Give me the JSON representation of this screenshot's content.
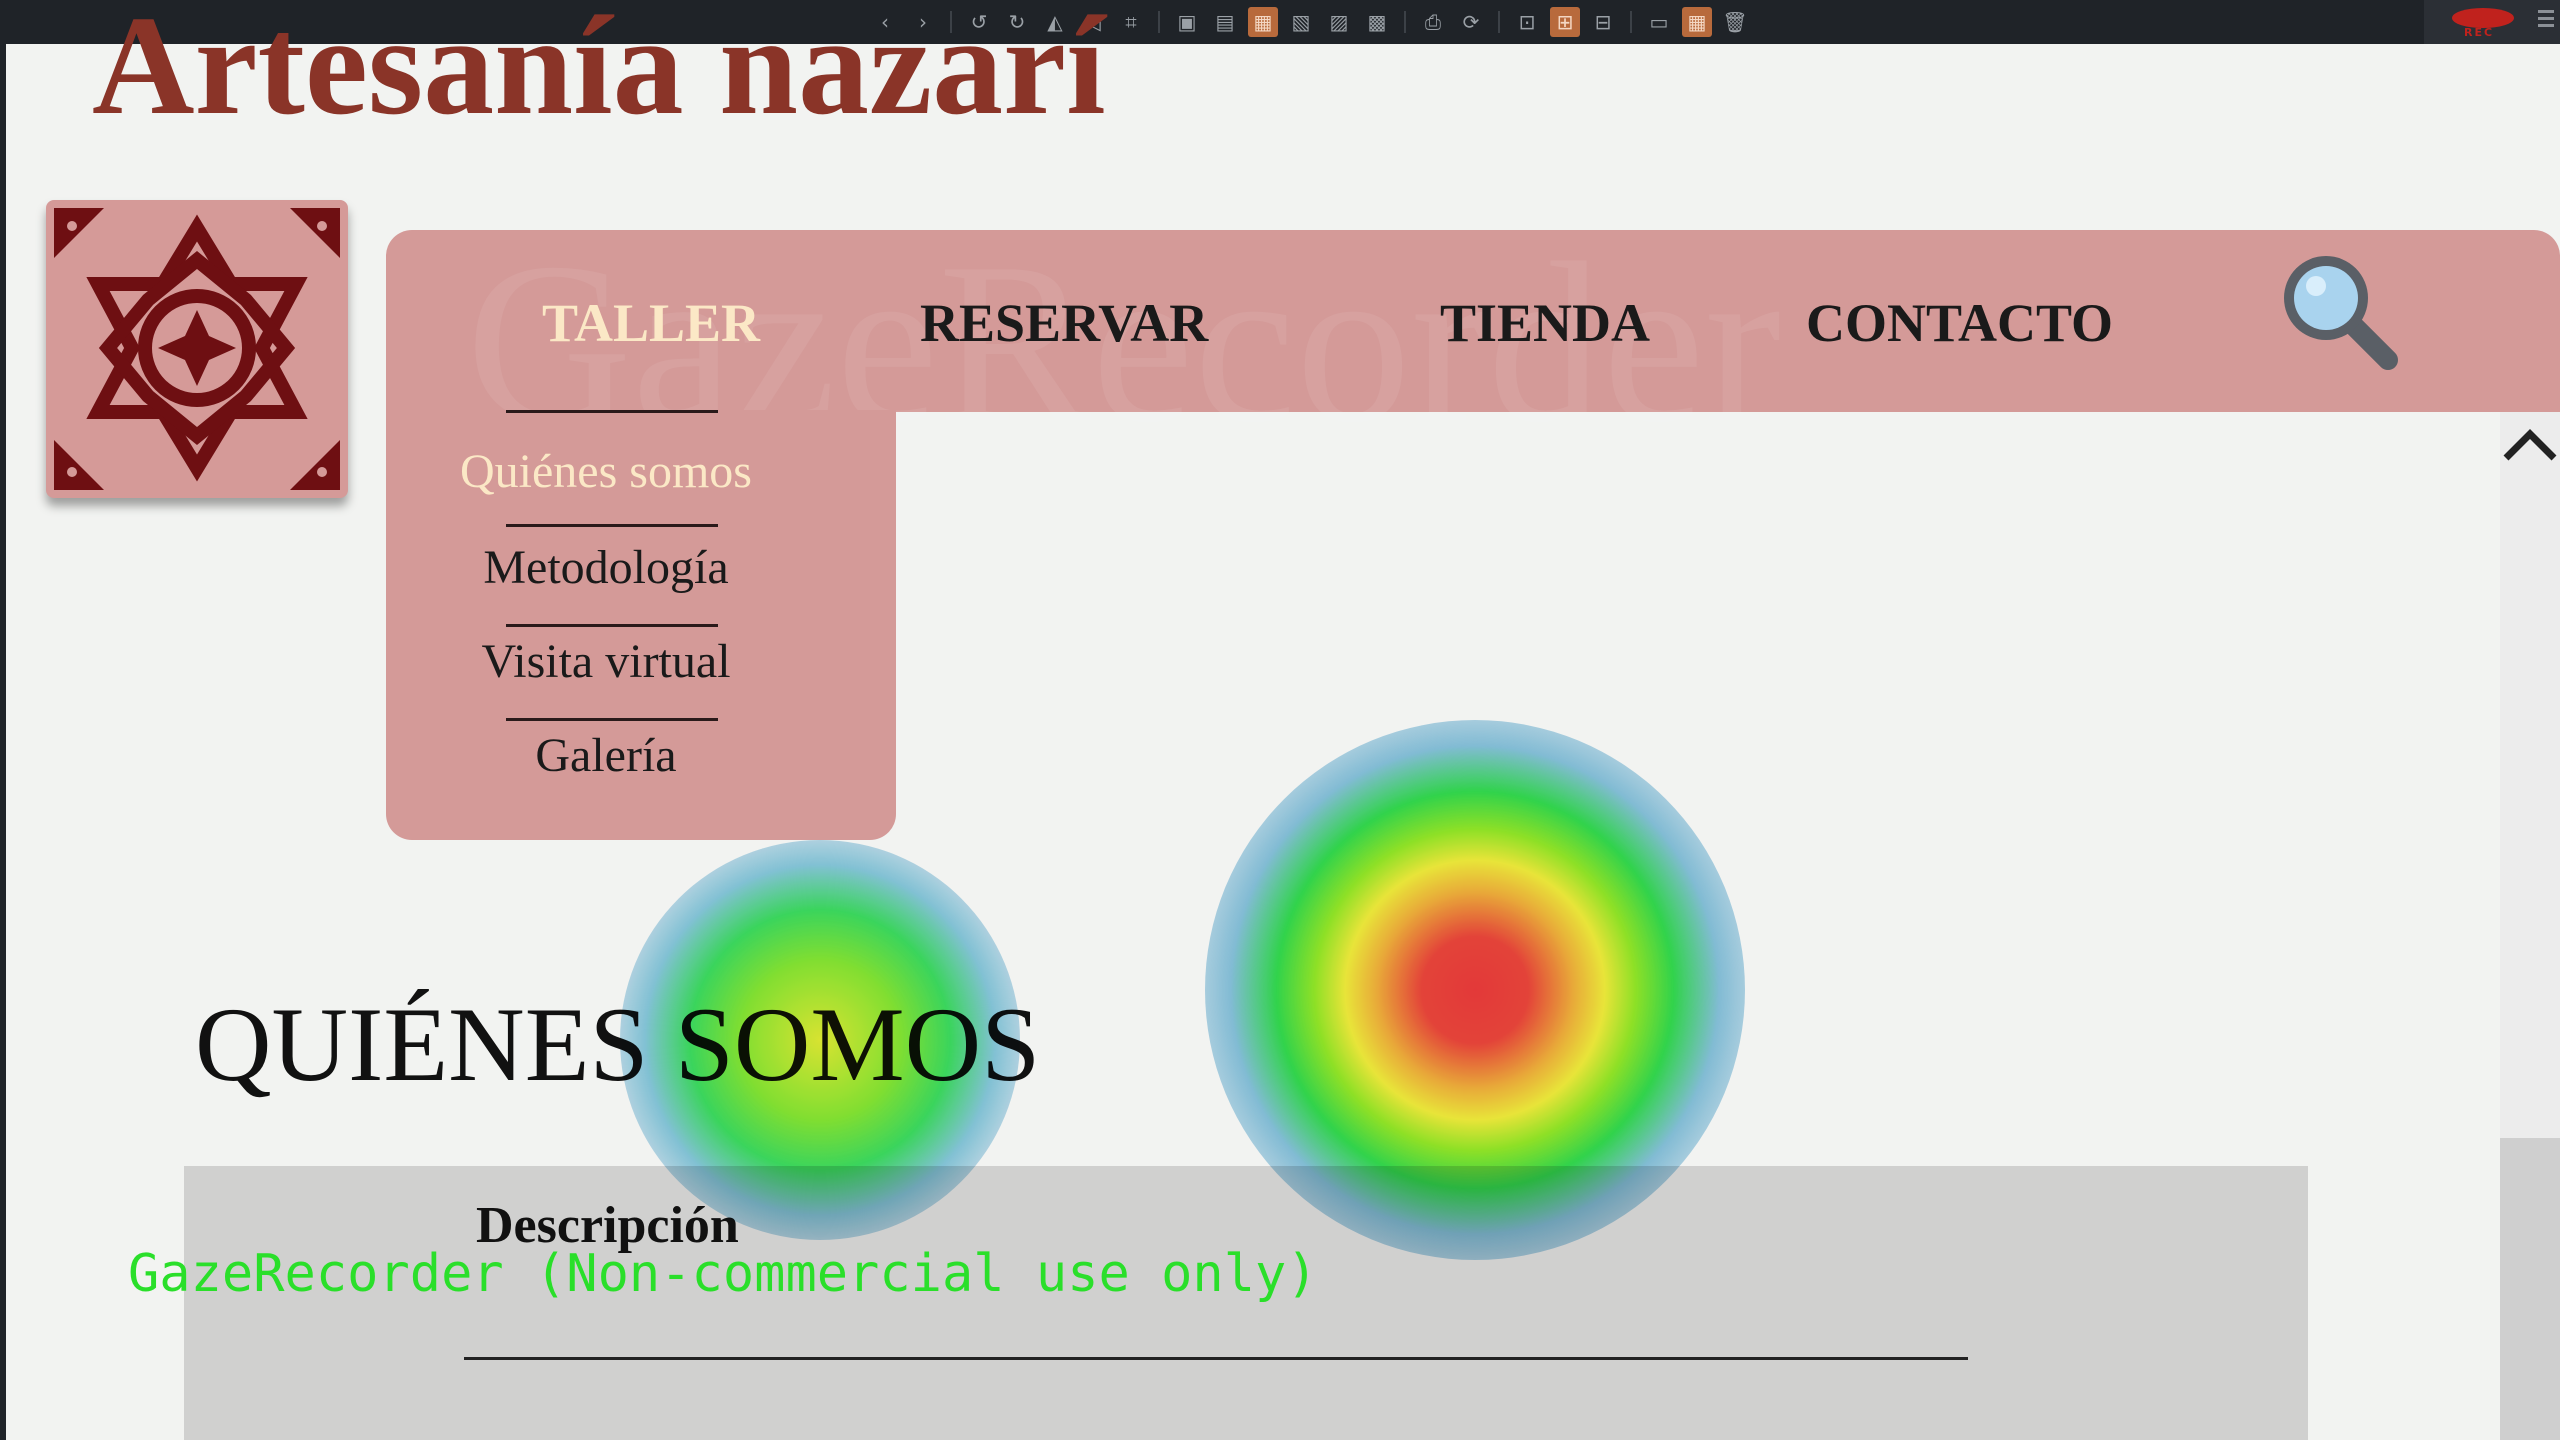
{
  "site": {
    "title": "Artesanía nazarí"
  },
  "nav": {
    "items": [
      {
        "label": "TALLER",
        "active": true
      },
      {
        "label": "RESERVAR",
        "active": false
      },
      {
        "label": "TIENDA",
        "active": false
      },
      {
        "label": "CONTACTO",
        "active": false
      }
    ],
    "watermark": "GazeRecorder",
    "search_icon": "magnifier-icon"
  },
  "dropdown": {
    "items": [
      {
        "label": "Quiénes somos",
        "active": true
      },
      {
        "label": "Metodología",
        "active": false
      },
      {
        "label": "Visita virtual",
        "active": false
      },
      {
        "label": "Galería",
        "active": false
      }
    ]
  },
  "main": {
    "heading": "QUIÉNES SOMOS",
    "description_title": "Descripción"
  },
  "recorder": {
    "label": "GazeRecorder (Non-commercial use only)",
    "status": "REC",
    "toolbar_icons": [
      "chevron-left-icon",
      "chevron-right-icon",
      "rotate-left-icon",
      "rotate-right-icon",
      "flip-icon",
      "mirror-icon",
      "crop-icon",
      "frame-icon",
      "lock-icon",
      "image-icon",
      "image-icon",
      "image-icon",
      "image-icon",
      "print-icon",
      "refresh-icon",
      "fit-icon",
      "expand-icon",
      "slideshow-icon",
      "image-icon",
      "grid-icon",
      "trash-icon"
    ]
  },
  "colors": {
    "title": "#8a3428",
    "nav_background": "#d49a98",
    "nav_active": "#fbe8c6",
    "toolbar_active": "#b86a3c",
    "gaze_label": "#2adf2a"
  }
}
